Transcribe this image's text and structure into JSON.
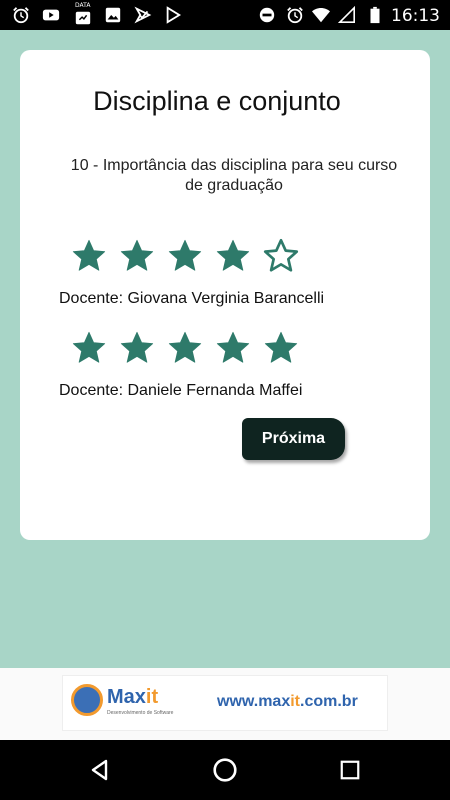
{
  "status_bar": {
    "time": "16:13",
    "left_icons": [
      "alarm-icon",
      "youtube-icon",
      "data-icon",
      "gallery-icon",
      "check-icon",
      "play-store-icon"
    ],
    "data_label": "DATA",
    "right_icons": [
      "do-not-disturb-icon",
      "alarm-icon",
      "wifi-icon",
      "signal-icon",
      "battery-icon"
    ]
  },
  "card": {
    "title": "Disciplina e conjunto",
    "question": "10 - Importância das disciplina para seu curso de graduação"
  },
  "ratings": [
    {
      "docente": "Docente: Giovana Verginia Barancelli",
      "rating": 4,
      "max": 5
    },
    {
      "docente": "Docente: Daniele Fernanda Maffei",
      "rating": 5,
      "max": 5
    }
  ],
  "next_button": {
    "label": "Próxima"
  },
  "ad": {
    "brand_main": "Max",
    "brand_accent": "it",
    "tagline": "Desenvolvimento de Software",
    "url_main": "www.max",
    "url_accent": "it",
    "url_tail": ".com.br"
  },
  "colors": {
    "background": "#a8d5c7",
    "star": "#2e7a6a",
    "button": "#0f2420"
  },
  "nav_bar": {
    "buttons": [
      "back-icon",
      "home-icon",
      "recents-icon"
    ]
  }
}
